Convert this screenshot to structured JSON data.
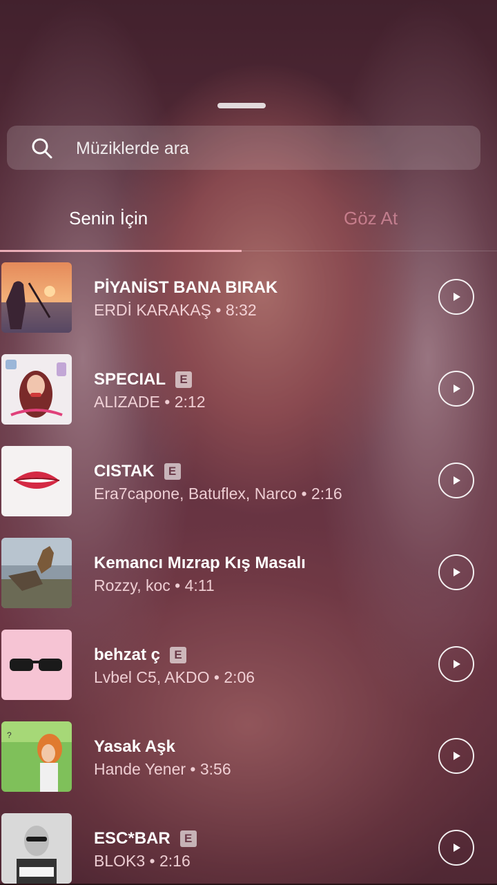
{
  "search": {
    "placeholder": "Müziklerde ara",
    "icon": "search-icon"
  },
  "tabs": [
    {
      "label": "Senin İçin",
      "active": true
    },
    {
      "label": "Göz At",
      "active": false
    }
  ],
  "tracks": [
    {
      "title": "PİYANİST BANA BIRAK",
      "artist": "ERDİ KARAKAŞ",
      "duration": "8:32",
      "explicit": false,
      "explicit_label": ""
    },
    {
      "title": "SPECIAL",
      "artist": "ALIZADE",
      "duration": "2:12",
      "explicit": true,
      "explicit_label": "E"
    },
    {
      "title": "CISTAK",
      "artist": "Era7capone, Batuflex, Narco",
      "duration": "2:16",
      "explicit": true,
      "explicit_label": "E"
    },
    {
      "title": "Kemancı Mızrap Kış Masalı",
      "artist": "Rozzy, koc",
      "duration": "4:11",
      "explicit": false,
      "explicit_label": ""
    },
    {
      "title": "behzat ç",
      "artist": "Lvbel C5, AKDO",
      "duration": "2:06",
      "explicit": true,
      "explicit_label": "E"
    },
    {
      "title": "Yasak Aşk",
      "artist": "Hande Yener",
      "duration": "3:56",
      "explicit": false,
      "explicit_label": ""
    },
    {
      "title": "ESC*BAR",
      "artist": "BLOK3",
      "duration": "2:16",
      "explicit": true,
      "explicit_label": "E"
    }
  ],
  "separator": " • ",
  "colors": {
    "overlay": "#6e374b",
    "tab_active": "#ffffff",
    "tab_inactive": "#ffaabe",
    "indicator": "#ffbec8"
  }
}
